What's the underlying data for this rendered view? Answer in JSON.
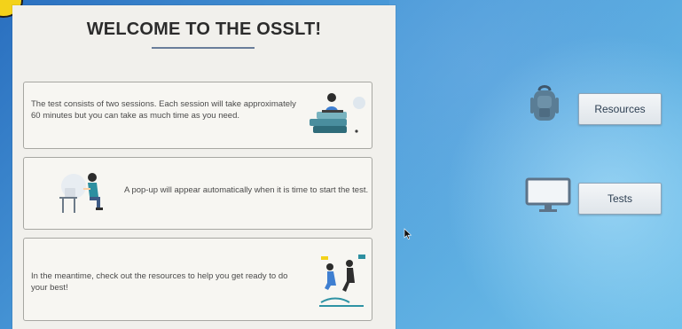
{
  "screen": {
    "title": "WELCOME TO THE OSSLT!"
  },
  "cards": [
    {
      "text": "The test consists of two sessions. Each session will take approximately 60 minutes but you can take as much time as you need."
    },
    {
      "text": "A pop-up will appear automatically when it is time to start the test."
    },
    {
      "text": "In the meantime, check out the resources to help you get ready to do your best!"
    }
  ],
  "launcher": {
    "resources_label": "Resources",
    "tests_label": "Tests"
  },
  "colors": {
    "desktop_blue": "#2a6fbf",
    "desktop_light": "#6fc0ea",
    "accent_yellow": "#f3d21a",
    "tile_border": "#8ea4b8"
  },
  "icons": {
    "corner": "yellow-badge",
    "card1": "reading-student-illustration",
    "card2": "computer-user-illustration",
    "card3": "celebrating-students-illustration",
    "resources": "backpack-icon",
    "tests": "monitor-icon",
    "pointer": "mouse-cursor-icon"
  }
}
